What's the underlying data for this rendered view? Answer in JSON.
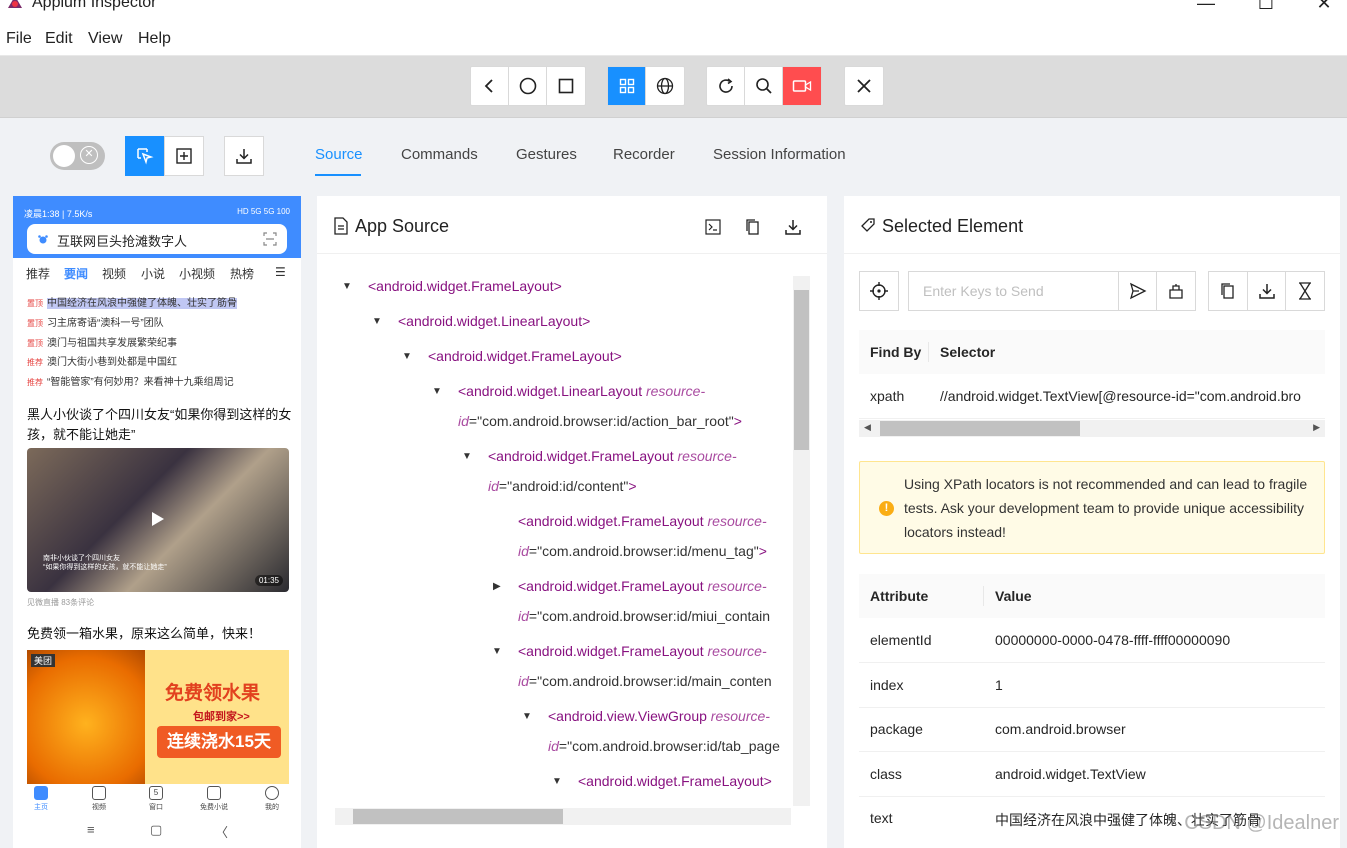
{
  "window": {
    "title": "Appium Inspector",
    "minimize": "—",
    "maximize": "☐",
    "close": "✕"
  },
  "menu": [
    "File",
    "Edit",
    "View",
    "Help"
  ],
  "tabs": [
    "Source",
    "Commands",
    "Gestures",
    "Recorder",
    "Session Information"
  ],
  "phone": {
    "status_left": "凌晨1:38 | 7.5K/s",
    "status_right": "HD 5G 5G 100",
    "search_text": "互联网巨头抢滩数字人",
    "tabs": [
      "推荐",
      "要闻",
      "视频",
      "小说",
      "小视频",
      "热榜"
    ],
    "news": [
      {
        "tag": "置顶",
        "text": "中国经济在风浪中强健了体魄、壮实了筋骨"
      },
      {
        "tag": "置顶",
        "text": "习主席寄语“澳科一号”团队"
      },
      {
        "tag": "置顶",
        "text": "澳门与祖国共享发展繁荣纪事"
      },
      {
        "tag": "推荐",
        "text": "澳门大街小巷到处都是中国红"
      },
      {
        "tag": "推荐",
        "text": "“智能管家”有何妙用？来看神十九乘组周记"
      }
    ],
    "article1": "黑人小伙谈了个四川女友“如果你得到这样的女孩，就不能让她走”",
    "video_caption_1": "南非小伙谈了个四川女友",
    "video_caption_2": "“如果你得到这样的女孩，就不能让她走”",
    "video_duration": "01:35",
    "video_meta": "见微直播  83条评论",
    "article2": "免费领一箱水果，原来这么简单，快来！",
    "ad_brand": "美团",
    "ad_line1": "免费领水果",
    "ad_line2": "包邮到家>>",
    "ad_line3": "连续浇水15天",
    "nav": [
      "主页",
      "视频",
      "窗口",
      "免费小说",
      "我的"
    ],
    "nav_window_count": "5",
    "sys_nav": [
      "≡",
      "▢",
      "〈"
    ]
  },
  "source": {
    "title": "App Source",
    "lines": [
      {
        "tag": "<android.widget.FrameLayout>"
      },
      {
        "tag": "<android.widget.LinearLayout>"
      },
      {
        "tag": "<android.widget.FrameLayout>"
      },
      {
        "tag": "<android.widget.LinearLayout",
        "attr": "resource-",
        "cont_attr": "id",
        "eq": "=",
        "val": "\"com.android.browser:id/action_bar_root\"",
        "end": ">"
      },
      {
        "tag": "<android.widget.FrameLayout",
        "attr": "resource-",
        "cont_attr": "id",
        "eq": "=",
        "val": "\"android:id/content\"",
        "end": ">"
      },
      {
        "tag": "<android.widget.FrameLayout",
        "attr": "resource-",
        "cont_attr": "id",
        "eq": "=",
        "val": "\"com.android.browser:id/menu_tag\"",
        "end": ">"
      },
      {
        "tag": "<android.widget.FrameLayout",
        "attr": "resource-",
        "cont_attr": "id",
        "eq": "=",
        "val": "\"com.android.browser:id/miui_contain",
        "end": ""
      },
      {
        "tag": "<android.widget.FrameLayout",
        "attr": "resource-",
        "cont_attr": "id",
        "eq": "=",
        "val": "\"com.android.browser:id/main_conten",
        "end": ""
      },
      {
        "tag": "<android.view.ViewGroup",
        "attr": "resource-",
        "cont_attr": "id",
        "eq": "=",
        "val": "\"com.android.browser:id/tab_page",
        "end": ""
      },
      {
        "tag": "<android.widget.FrameLayout>"
      }
    ]
  },
  "selected": {
    "title": "Selected Element",
    "keys_placeholder": "Enter Keys to Send",
    "find_by_header": "Find By",
    "selector_header": "Selector",
    "find_by": "xpath",
    "selector": "//android.widget.TextView[@resource-id=\"com.android.bro",
    "warning": "Using XPath locators is not recommended and can lead to fragile tests. Ask your development team to provide unique accessibility locators instead!",
    "attr_header": "Attribute",
    "value_header": "Value",
    "attributes": [
      {
        "name": "elementId",
        "value": "00000000-0000-0478-ffff-ffff00000090"
      },
      {
        "name": "index",
        "value": "1"
      },
      {
        "name": "package",
        "value": "com.android.browser"
      },
      {
        "name": "class",
        "value": "android.widget.TextView"
      },
      {
        "name": "text",
        "value": "中国经济在风浪中强健了体魄、壮实了筋骨"
      }
    ]
  },
  "watermark": "CSDN @Idealner",
  "colors": {
    "accent": "#1890ff",
    "record": "#ff4d4f",
    "warning_bg": "#fffbe6",
    "warning_icon": "#faad14",
    "phone_header": "#3f8cff"
  }
}
